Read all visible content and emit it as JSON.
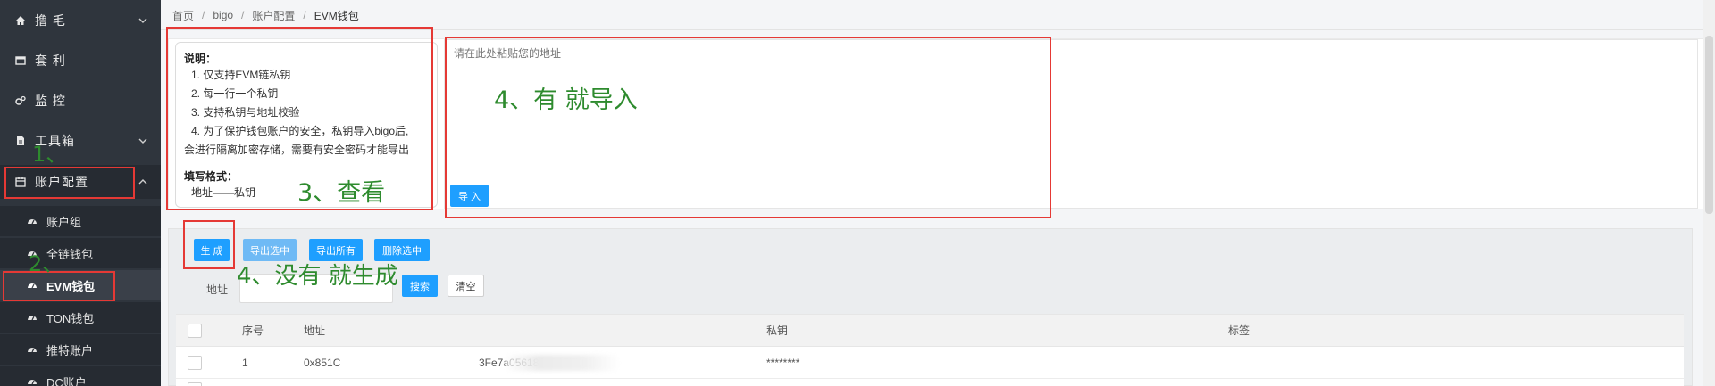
{
  "sidebar": {
    "items": [
      {
        "label": "撸 毛",
        "icon": "home-icon",
        "chevron": "chevron-down-icon"
      },
      {
        "label": "套 利",
        "icon": "window-icon",
        "chevron": ""
      },
      {
        "label": "监 控",
        "icon": "gears-icon",
        "chevron": ""
      },
      {
        "label": "工具箱",
        "icon": "file-icon",
        "chevron": "chevron-down-icon"
      },
      {
        "label": "账户配置",
        "icon": "calendar-icon",
        "chevron": "chevron-up-icon"
      }
    ],
    "sub_items": [
      {
        "label": "账户组",
        "icon": "dashboard-icon"
      },
      {
        "label": "全链钱包",
        "icon": "dashboard-icon"
      },
      {
        "label": "EVM钱包",
        "icon": "dashboard-icon",
        "selected": true
      },
      {
        "label": "TON钱包",
        "icon": "dashboard-icon"
      },
      {
        "label": "推特账户",
        "icon": "dashboard-icon"
      },
      {
        "label": "DC账户",
        "icon": "dashboard-icon"
      }
    ]
  },
  "breadcrumb": [
    "首页",
    "bigo",
    "账户配置",
    "EVM钱包"
  ],
  "breadcrumb_sep": "/",
  "info": {
    "title": "说明：",
    "lines": [
      "1. 仅支持EVM链私钥",
      "2. 每一行一个私钥",
      "3. 支持私钥与地址校验",
      "4. 为了保护钱包账户的安全，私钥导入bigo后,",
      "会进行隔离加密存储，需要有安全密码才能导出"
    ],
    "format_title": "填写格式：",
    "format_line": "地址——私钥"
  },
  "import": {
    "placeholder": "请在此处粘贴您的地址",
    "button": "导 入"
  },
  "toolbar": {
    "generate": "生 成",
    "export_selected": "导出选中",
    "export_all": "导出所有",
    "delete_selected": "删除选中"
  },
  "search": {
    "label": "地址",
    "value": "",
    "search_button": "搜索",
    "clear_button": "清空"
  },
  "table": {
    "columns": [
      "序号",
      "地址",
      "私钥",
      "标签"
    ],
    "rows": [
      {
        "index": "1",
        "address_prefix": "0x851C",
        "address_suffix": "3Fe7a0561896845Fb",
        "private_key": "********",
        "tag": ""
      }
    ]
  },
  "annotations": {
    "step1": "1、",
    "step2": "2、",
    "step3": "3、查看",
    "step4_import": "4、有 就导入",
    "step4_generate": "4、没有  就生成",
    "box_color": "#e53935",
    "text_color": "#2e8b2e"
  },
  "colors": {
    "sidebar_bg": "#2f353d",
    "primary": "#1e9fff"
  }
}
